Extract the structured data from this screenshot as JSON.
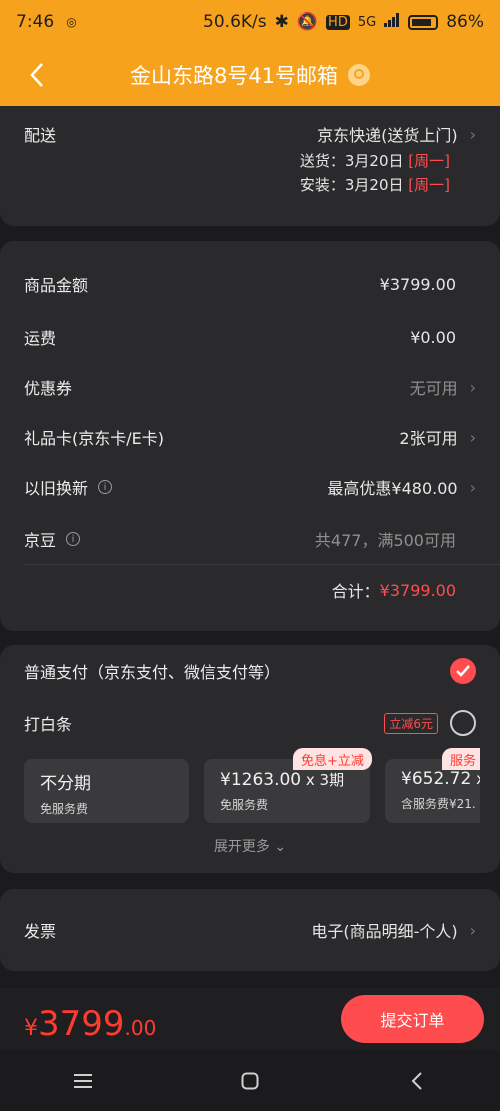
{
  "status_bar": {
    "time": "7:46",
    "network_speed": "50.6K/s",
    "hd_label": "HD",
    "signal_label": "5G",
    "battery": "86%",
    "battery_level": 0.86
  },
  "header": {
    "title": "金山东路8号41号邮箱",
    "back_icon": "chevron-left-icon",
    "location_icon": "location-pin-icon"
  },
  "delivery": {
    "label": "配送",
    "carrier": "京东快递(送货上门)",
    "ship_label": "送货：",
    "ship_date": "3月20日",
    "ship_weekday": "[周一]",
    "install_label": "安装：",
    "install_date": "3月20日",
    "install_weekday": "[周一]"
  },
  "summary": {
    "goods_amount_label": "商品金额",
    "goods_amount": "¥3799.00",
    "shipping_label": "运费",
    "shipping": "¥0.00",
    "coupon_label": "优惠券",
    "coupon_value": "无可用",
    "giftcard_label": "礼品卡(京东卡/E卡)",
    "giftcard_value": "2张可用",
    "tradein_label": "以旧换新",
    "tradein_value": "最高优惠¥480.00",
    "jingdou_label": "京豆",
    "jingdou_value": "共477，满500可用",
    "total_label": "合计：",
    "total_value": "¥3799.00"
  },
  "payment": {
    "normal_label": "普通支付（京东支付、微信支付等）",
    "baitiao_label": "打白条",
    "baitiao_promo": "立减6元",
    "plans": [
      {
        "main": "不分期",
        "sub": "免服务费",
        "tag": ""
      },
      {
        "main_price": "¥1263.00",
        "main_rest": " x 3期",
        "sub": "免服务费",
        "tag": "免息+立减"
      },
      {
        "main_price": "¥652.72",
        "main_rest": " x",
        "sub": "含服务费¥21.",
        "tag": "服务"
      }
    ],
    "expand_more": "展开更多"
  },
  "invoice": {
    "label": "发票",
    "value": "电子(商品明细-个人)"
  },
  "footer": {
    "price_currency": "¥",
    "price_integer": "3799",
    "price_decimal": ".00",
    "submit_label": "提交订单"
  },
  "colors": {
    "header_bg": "#f7a21c",
    "accent_red": "#ff4d4f",
    "card_bg": "#2a2a2c",
    "page_bg": "#1b1b1d"
  }
}
